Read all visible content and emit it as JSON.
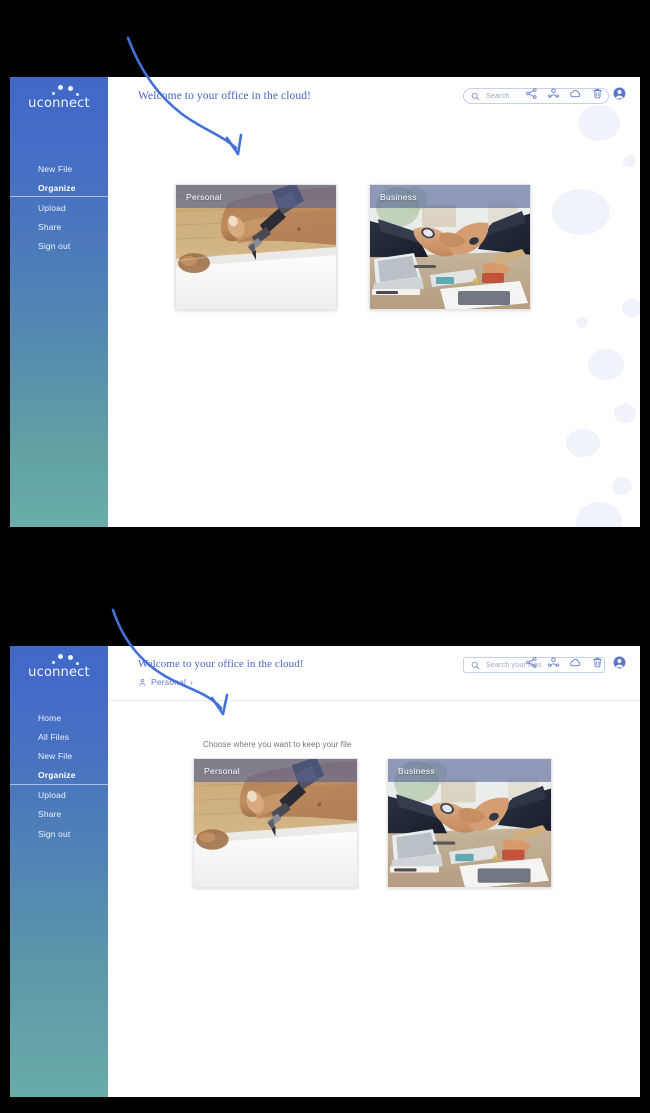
{
  "brand": {
    "name": "uconnect",
    "logo_dots": 4
  },
  "colors": {
    "sidebar_top": "#4167c9",
    "sidebar_bottom": "#6aada9",
    "accent_blue": "#4a64c0",
    "annotation_arrow": "#4471d8",
    "bubble": "#f0f3fa",
    "card_label_overlay": "rgba(86,100,150,0.62)"
  },
  "panel_1": {
    "header": {
      "welcome": "Welcome to your office in the cloud!",
      "search": {
        "placeholder": "Search",
        "value": "",
        "icon": "search-icon"
      },
      "icons": [
        {
          "name": "share-icon",
          "label": "Share"
        },
        {
          "name": "contacts-group-icon",
          "label": "Contacts"
        },
        {
          "name": "cloud-icon",
          "label": "Cloud"
        },
        {
          "name": "trash-icon",
          "label": "Trash"
        },
        {
          "name": "user-avatar-icon",
          "label": "Account"
        }
      ]
    },
    "sidebar": {
      "items": [
        {
          "label": "New File",
          "active": false
        },
        {
          "label": "Organize",
          "active": true
        },
        {
          "label": "Upload",
          "active": false
        },
        {
          "label": "Share",
          "active": false
        },
        {
          "label": "Sign out",
          "active": false
        }
      ]
    },
    "cards": [
      {
        "label": "Personal",
        "image": "hand-writing-with-pen-photo"
      },
      {
        "label": "Business",
        "image": "business-handshake-photo"
      }
    ]
  },
  "panel_2": {
    "header": {
      "welcome": "Welcome to your office in the cloud!",
      "breadcrumb": {
        "icon": "person-outline-icon",
        "label": "Personal",
        "chevron": "›"
      },
      "search": {
        "placeholder": "Search your files",
        "value": "",
        "icon": "search-icon"
      },
      "icons": [
        {
          "name": "share-icon",
          "label": "Share"
        },
        {
          "name": "contacts-group-icon",
          "label": "Contacts"
        },
        {
          "name": "cloud-icon",
          "label": "Cloud"
        },
        {
          "name": "trash-icon",
          "label": "Trash"
        },
        {
          "name": "user-avatar-icon",
          "label": "Account"
        }
      ]
    },
    "sidebar": {
      "items": [
        {
          "label": "Home",
          "active": false
        },
        {
          "label": "All Files",
          "active": false
        },
        {
          "label": "New File",
          "active": false
        },
        {
          "label": "Organize",
          "active": true
        },
        {
          "label": "Upload",
          "active": false
        },
        {
          "label": "Share",
          "active": false
        },
        {
          "label": "Sign out",
          "active": false
        }
      ]
    },
    "prompt": "Choose where you want to keep your file",
    "cards": [
      {
        "label": "Personal",
        "image": "hand-writing-with-pen-photo"
      },
      {
        "label": "Business",
        "image": "business-handshake-photo"
      }
    ]
  },
  "annotations": [
    {
      "name": "curved-arrow-to-personal-card",
      "type": "arrow",
      "color": "#4471d8"
    },
    {
      "name": "curved-arrow-to-personal-card",
      "type": "arrow",
      "color": "#4471d8"
    }
  ]
}
